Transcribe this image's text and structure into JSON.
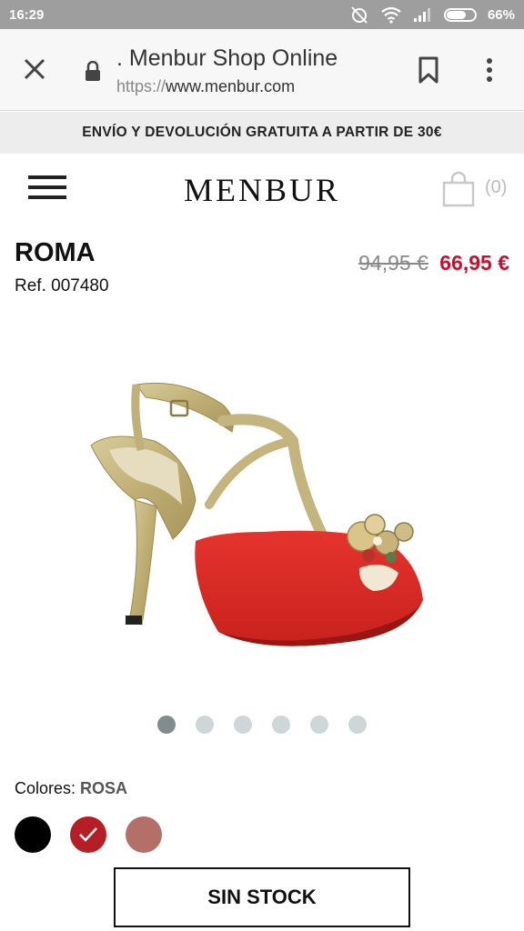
{
  "status_bar": {
    "time": "16:29",
    "battery": "66%"
  },
  "browser": {
    "title": ". Menbur Shop Online",
    "url_protocol": "https://",
    "url_host": "www.menbur.com"
  },
  "promo": {
    "text": "ENVÍO Y DEVOLUCIÓN GRATUITA A PARTIR DE 30€"
  },
  "header": {
    "logo": "MENBUR",
    "cart_count": "(0)"
  },
  "product": {
    "name": "ROMA",
    "ref": "Ref. 007480",
    "price_old": "94,95 €",
    "price_new": "66,95 €",
    "gallery": {
      "count": 6,
      "active_index": 0
    }
  },
  "colors": {
    "label": "Colores:",
    "selected": "ROSA",
    "swatches": [
      {
        "color": "#000000",
        "selected": false
      },
      {
        "color": "#b41e24",
        "selected": true
      },
      {
        "color": "#b36f68",
        "selected": false
      }
    ]
  },
  "stock_button": {
    "label": "SIN STOCK"
  },
  "theme": {
    "accent_price": "#c8102e",
    "promo_bg": "#ededed",
    "status_bg": "#9e9e9e"
  }
}
